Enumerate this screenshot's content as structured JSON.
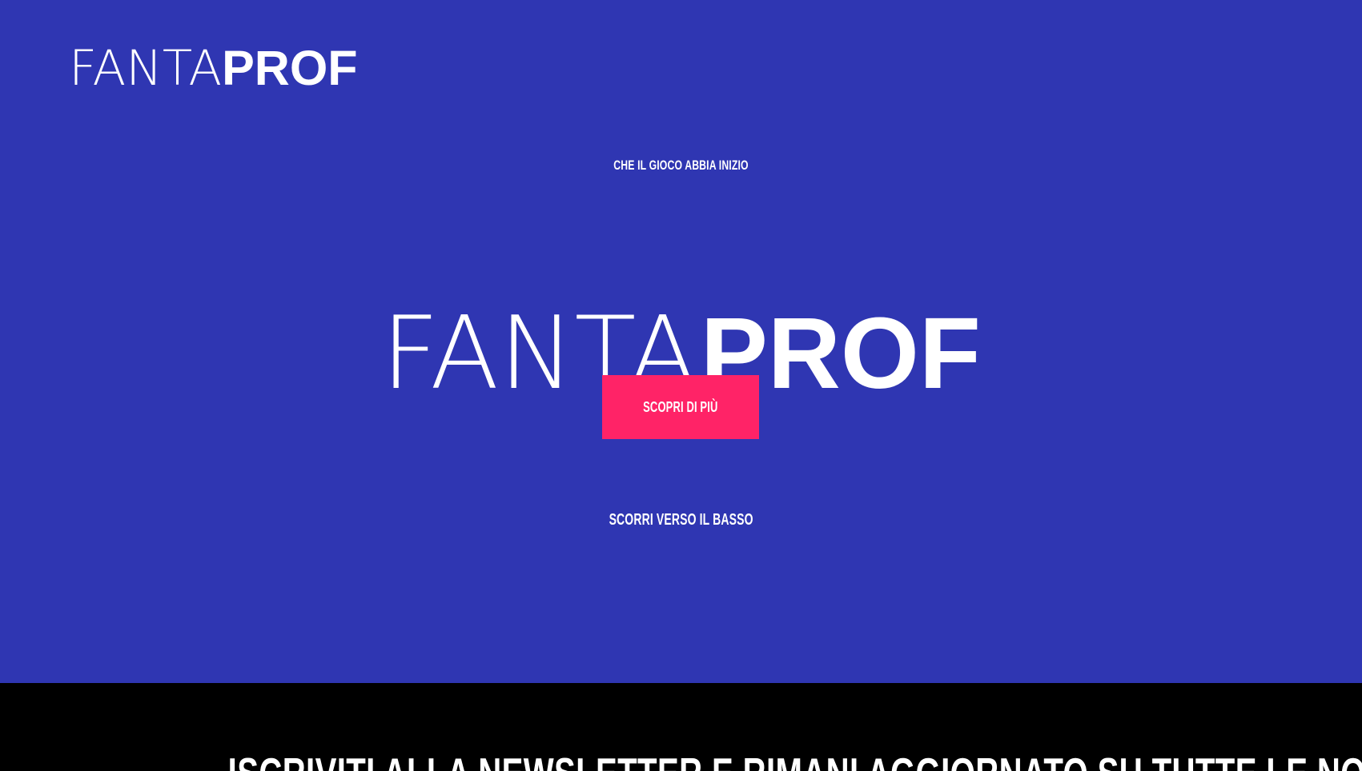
{
  "header": {
    "logo_light": "FANTA",
    "logo_bold": "PROF"
  },
  "hero": {
    "kicker": "CHE IL GIOCO ABBIA INIZIO",
    "title_light": "FANTA",
    "title_bold": "PROF",
    "cta_label": "SCOPRI DI PIÙ",
    "scroll_label": "SCORRI VERSO IL BASSO"
  },
  "newsletter": {
    "heading": "ISCRIVITI ALLA NEWSLETTER E RIMANI AGGIORNATO SU TUTTE LE NOVITÀ !"
  },
  "colors": {
    "hero_background": "#2f36b2",
    "cta_background": "#ff2367",
    "newsletter_background": "#000000",
    "text": "#ffffff"
  }
}
